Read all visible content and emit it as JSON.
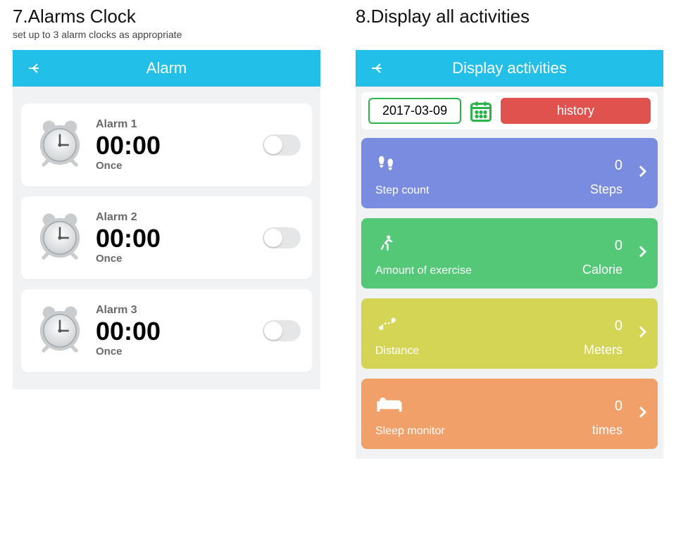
{
  "left": {
    "heading": "7.Alarms Clock",
    "subheading": "set up to 3 alarm clocks as appropriate",
    "screenTitle": "Alarm",
    "alarms": [
      {
        "name": "Alarm 1",
        "time": "00:00",
        "repeat": "Once"
      },
      {
        "name": "Alarm 2",
        "time": "00:00",
        "repeat": "Once"
      },
      {
        "name": "Alarm 3",
        "time": "00:00",
        "repeat": "Once"
      }
    ]
  },
  "right": {
    "heading": "8.Display all activities",
    "subheading": "",
    "screenTitle": "Display activities",
    "date": "2017-03-09",
    "historyLabel": "history",
    "cards": [
      {
        "label": "Step count",
        "value": "0",
        "unit": "Steps",
        "color": "c-blue",
        "icon": "footprints-icon"
      },
      {
        "label": "Amount of exercise",
        "value": "0",
        "unit": "Calorie",
        "color": "c-green",
        "icon": "runner-icon"
      },
      {
        "label": "Distance",
        "value": "0",
        "unit": "Meters",
        "color": "c-yellow",
        "icon": "route-icon"
      },
      {
        "label": "Sleep monitor",
        "value": "0",
        "unit": "times",
        "color": "c-orange",
        "icon": "bed-icon"
      }
    ]
  }
}
